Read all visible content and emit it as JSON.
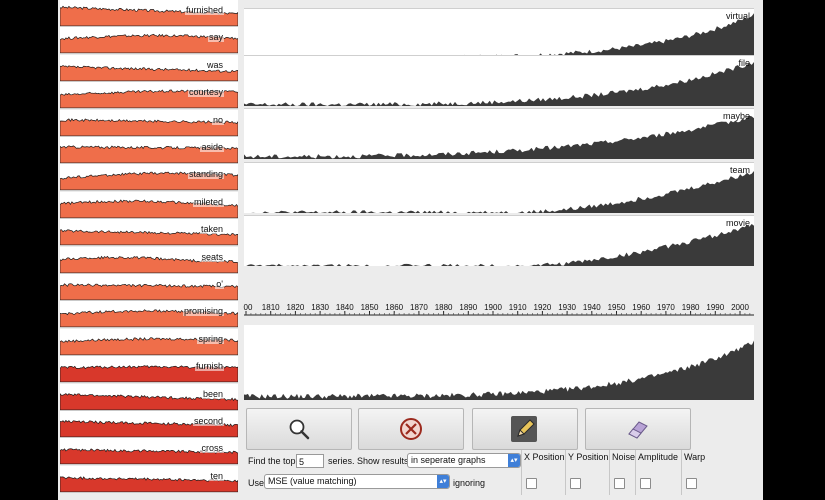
{
  "thumbnails": [
    {
      "label": "furnished",
      "color": "#ef6e4a"
    },
    {
      "label": "say",
      "color": "#ef6e4a"
    },
    {
      "label": "was",
      "color": "#ef6e4a"
    },
    {
      "label": "courtesy",
      "color": "#ef6e4a"
    },
    {
      "label": "no",
      "color": "#ef6e4a"
    },
    {
      "label": "aside",
      "color": "#ef6e4a"
    },
    {
      "label": "standing",
      "color": "#ef6e4a"
    },
    {
      "label": "mileted",
      "color": "#ef6e4a"
    },
    {
      "label": "taken",
      "color": "#ef6e4a"
    },
    {
      "label": "seats",
      "color": "#ef6e4a"
    },
    {
      "label": "o'",
      "color": "#ef6e4a"
    },
    {
      "label": "promising",
      "color": "#ef6e4a"
    },
    {
      "label": "spring",
      "color": "#ef6e4a"
    },
    {
      "label": "furnish",
      "color": "#d8382b"
    },
    {
      "label": "been",
      "color": "#d8382b"
    },
    {
      "label": "second",
      "color": "#d8382b"
    },
    {
      "label": "cross",
      "color": "#d8382b"
    },
    {
      "label": "ten",
      "color": "#d8382b"
    }
  ],
  "main_charts": [
    {
      "label": "virtual"
    },
    {
      "label": "file"
    },
    {
      "label": "maybe"
    },
    {
      "label": "team"
    },
    {
      "label": "movie"
    }
  ],
  "axis_ticks": [
    "00",
    "1810",
    "1820",
    "1830",
    "1840",
    "1850",
    "1860",
    "1870",
    "1880",
    "1890",
    "1900",
    "1910",
    "1920",
    "1930",
    "1940",
    "1950",
    "1960",
    "1970",
    "1980",
    "1990",
    "2000"
  ],
  "toolbar": [
    {
      "icon": "magnifier-icon"
    },
    {
      "icon": "clear-icon"
    },
    {
      "icon": "pencil-icon"
    },
    {
      "icon": "eraser-icon"
    }
  ],
  "controls": {
    "find_label": "Find the top",
    "top_n": "5",
    "series_label": "series. Show results",
    "show_mode": "in seperate graphs",
    "use_label": "Use",
    "metric": "MSE (value matching)",
    "ignoring_label": "ignoring"
  },
  "ignore_options": [
    "X Position",
    "Y Position",
    "Noise",
    "Amplitude",
    "Warp"
  ],
  "colors": {
    "chart_fill": "#3a3a3a",
    "thumb_orange": "#ef6e4a",
    "thumb_red": "#d8382b",
    "accent": "#3f7fd8"
  }
}
